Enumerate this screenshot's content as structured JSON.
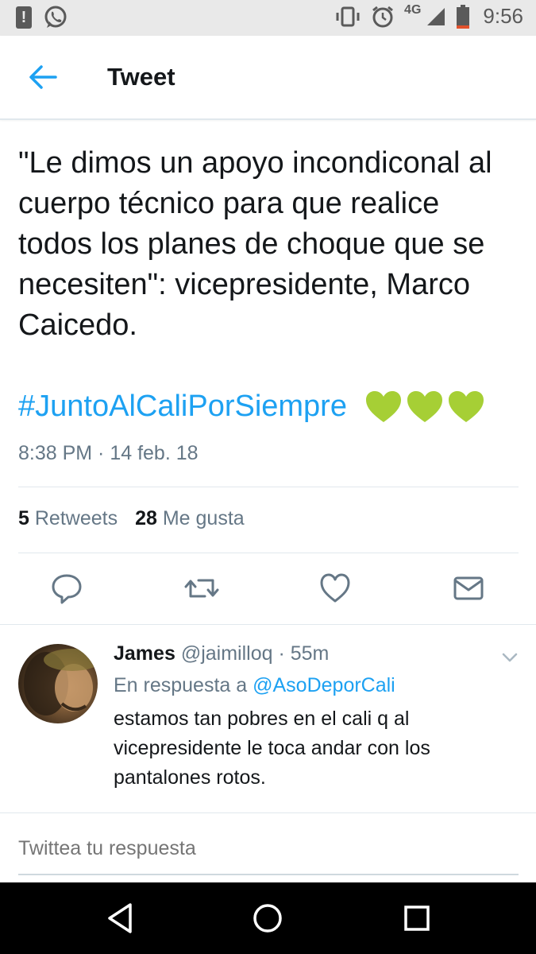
{
  "status_bar": {
    "time": "9:56",
    "network": "4G",
    "icons": [
      "notification-icon",
      "whatsapp-icon",
      "vibrate-icon",
      "alarm-icon",
      "signal-icon",
      "battery-icon"
    ]
  },
  "header": {
    "title": "Tweet",
    "back_icon": "back-arrow-icon"
  },
  "tweet": {
    "text": "\"Le dimos un apoyo incondiconal al cuerpo técnico para que realice todos los planes de choque que se necesiten\": vicepresidente, Marco Caicedo.",
    "hashtag": "#JuntoAlCaliPorSiempre",
    "emoji": "green-heart-icon",
    "timestamp": "8:38 PM · 14 feb. 18",
    "retweets_count": "5",
    "retweets_label": "Retweets",
    "likes_count": "28",
    "likes_label": "Me gusta",
    "accent_color": "#1da1f2",
    "heart_color": "#a6cf35"
  },
  "actions": [
    "reply-icon",
    "retweet-icon",
    "like-icon",
    "message-icon"
  ],
  "reply": {
    "name": "James",
    "handle": "@jaimilloq",
    "time": "55m",
    "separator": "·",
    "in_reply_prefix": "En respuesta a",
    "in_reply_handle": "@AsoDeporCali",
    "text": "estamos tan pobres en el cali q al vicepresidente le toca andar con los pantalones rotos."
  },
  "composer": {
    "placeholder": "Twittea tu respuesta"
  },
  "nav": [
    "back-triangle-icon",
    "home-circle-icon",
    "recents-square-icon"
  ]
}
